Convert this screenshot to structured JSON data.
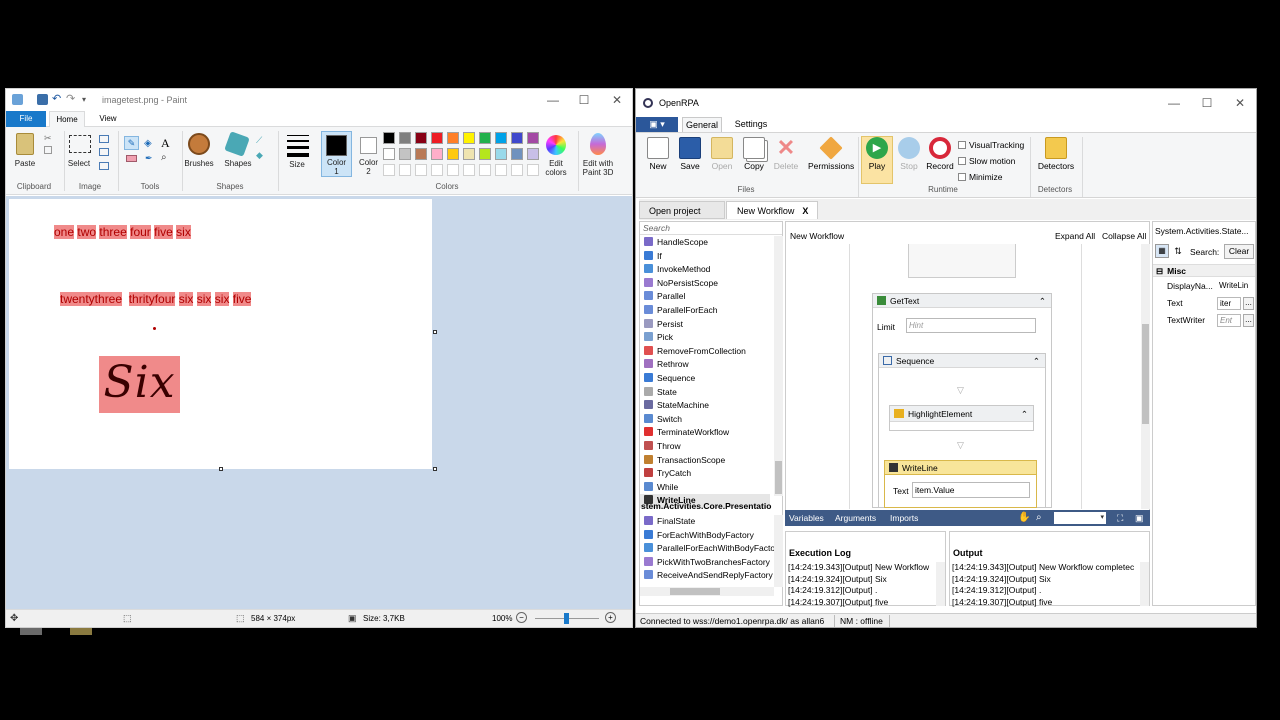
{
  "paint": {
    "title": "imagetest.png - Paint",
    "tabs": {
      "file": "File",
      "home": "Home",
      "view": "View"
    },
    "clipboard": {
      "paste": "Paste",
      "group": "Clipboard"
    },
    "image": {
      "select": "Select",
      "group": "Image"
    },
    "tools": {
      "group": "Tools"
    },
    "shapes": {
      "brushes": "Brushes",
      "shapes": "Shapes",
      "group": "Shapes"
    },
    "size_label": "Size",
    "color1": "Color\n1",
    "color1_line1": "Color",
    "color1_line2": "1",
    "color2_line1": "Color",
    "color2_line2": "2",
    "colors_group": "Colors",
    "edit_colors_line1": "Edit",
    "edit_colors_line2": "colors",
    "edit3d_line1": "Edit with",
    "edit3d_line2": "Paint 3D",
    "palette": [
      "#000000",
      "#7f7f7f",
      "#880015",
      "#ed1c24",
      "#ff7f27",
      "#fff200",
      "#22b14c",
      "#00a2e8",
      "#3f48cc",
      "#a349a4",
      "#ffffff",
      "#c3c3c3",
      "#b97a57",
      "#ffaec9",
      "#ffc90e",
      "#efe4b0",
      "#b5e61d",
      "#99d9ea",
      "#7092be",
      "#c8bfe7"
    ],
    "canvas": {
      "line1_words": [
        "one",
        "two",
        "three",
        "four",
        "five",
        "six"
      ],
      "line2_words": [
        "twentythree",
        "thrityfour",
        "six",
        "six",
        "six",
        "five"
      ],
      "handwritten": "Six"
    },
    "status": {
      "dimensions": "584 × 374px",
      "size": "Size: 3,7KB",
      "zoom": "100%"
    }
  },
  "rpa": {
    "title": "OpenRPA",
    "tabs": {
      "general": "General",
      "settings": "Settings"
    },
    "ribbon": {
      "new": "New",
      "save": "Save",
      "open": "Open",
      "copy": "Copy",
      "delete": "Delete",
      "permissions": "Permissions",
      "files_group": "Files",
      "play": "Play",
      "stop": "Stop",
      "record": "Record",
      "visual_tracking": "VisualTracking",
      "slow_motion": "Slow motion",
      "minimize": "Minimize",
      "runtime_group": "Runtime",
      "detectors": "Detectors",
      "detectors_group": "Detectors"
    },
    "doc_tabs": {
      "open_project": "Open project",
      "new_workflow": "New Workflow",
      "close": "X"
    },
    "toolbox": {
      "search": "Search",
      "items": [
        "HandleScope",
        "If",
        "InvokeMethod",
        "NoPersistScope",
        "Parallel",
        "ParallelForEach",
        "Persist",
        "Pick",
        "RemoveFromCollection",
        "Rethrow",
        "Sequence",
        "State",
        "StateMachine",
        "Switch",
        "TerminateWorkflow",
        "Throw",
        "TransactionScope",
        "TryCatch",
        "While",
        "WriteLine"
      ],
      "section2": "stem.Activities.Core.Presentatio",
      "items2": [
        "FinalState",
        "ForEachWithBodyFactory",
        "ParallelForEachWithBodyFactory",
        "PickWithTwoBranchesFactory",
        "ReceiveAndSendReplyFactory"
      ]
    },
    "designer": {
      "breadcrumb": "New Workflow",
      "expand_all": "Expand All",
      "collapse_all": "Collapse All",
      "gettext": "GetText",
      "limit_label": "Limit",
      "limit_hint": "Hint",
      "sequence": "Sequence",
      "highlight": "HighlightElement",
      "writeline": "WriteLine",
      "text_label": "Text",
      "text_value": "item.Value",
      "footer": {
        "variables": "Variables",
        "arguments": "Arguments",
        "imports": "Imports"
      }
    },
    "properties": {
      "header": "System.Activities.State...",
      "search": "Search:",
      "clear": "Clear",
      "misc": "Misc",
      "rows": [
        {
          "name": "DisplayNa...",
          "value": "WriteLin"
        },
        {
          "name": "Text",
          "value": "iter"
        },
        {
          "name": "TextWriter",
          "value": "Ent"
        }
      ]
    },
    "exec_log": {
      "title": "Execution Log",
      "lines": [
        "[14:24:19.343][Output] New Workflow",
        "[14:24:19.324][Output] Six",
        "[14:24:19.312][Output] .",
        "[14:24:19.307][Output] five"
      ]
    },
    "output": {
      "title": "Output",
      "lines": [
        "[14:24:19.343][Output] New Workflow completec",
        "[14:24:19.324][Output] Six",
        "[14:24:19.312][Output] .",
        "[14:24:19.307][Output] five"
      ]
    },
    "status": {
      "connection": "Connected to wss://demo1.openrpa.dk/ as allan6",
      "nm": "NM : offline"
    }
  },
  "colors": {
    "paint_accent": "#1979ca",
    "highlight": "#f08a8a",
    "writeline_header": "#f8e59a",
    "designer_footer": "#3e5a86"
  }
}
